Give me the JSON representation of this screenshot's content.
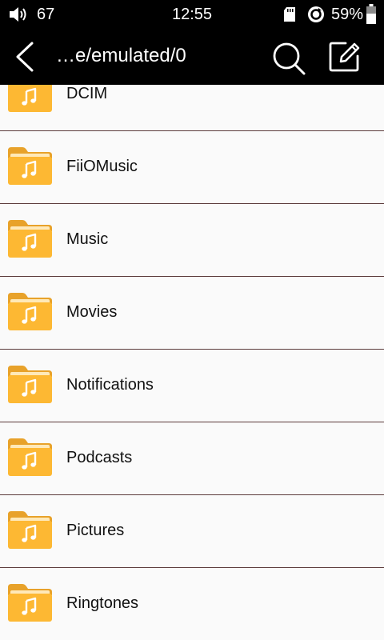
{
  "status_bar": {
    "volume_icon": "speaker-icon",
    "volume_level": "67",
    "time": "12:55",
    "sd_icon": "sd-card-icon",
    "sync_icon": "sync-icon",
    "battery_percent": "59%",
    "battery_icon": "battery-icon",
    "battery_level": 0.59
  },
  "toolbar": {
    "back_icon": "back-arrow-icon",
    "path": "…e/emulated/0",
    "search_icon": "search-icon",
    "edit_icon": "edit-icon"
  },
  "colors": {
    "bar_background": "#000000",
    "list_background": "#fafafa",
    "divider": "#5a3a3a",
    "folder_body": "#fdb833",
    "folder_tab": "#e8a22a",
    "folder_paper": "#ffe9b8"
  },
  "folders": [
    {
      "name": "DCIM",
      "icon": "music-folder-icon"
    },
    {
      "name": "FiiOMusic",
      "icon": "music-folder-icon"
    },
    {
      "name": "Music",
      "icon": "music-folder-icon"
    },
    {
      "name": "Movies",
      "icon": "music-folder-icon"
    },
    {
      "name": "Notifications",
      "icon": "music-folder-icon"
    },
    {
      "name": "Podcasts",
      "icon": "music-folder-icon"
    },
    {
      "name": "Pictures",
      "icon": "music-folder-icon"
    },
    {
      "name": "Ringtones",
      "icon": "music-folder-icon"
    }
  ]
}
